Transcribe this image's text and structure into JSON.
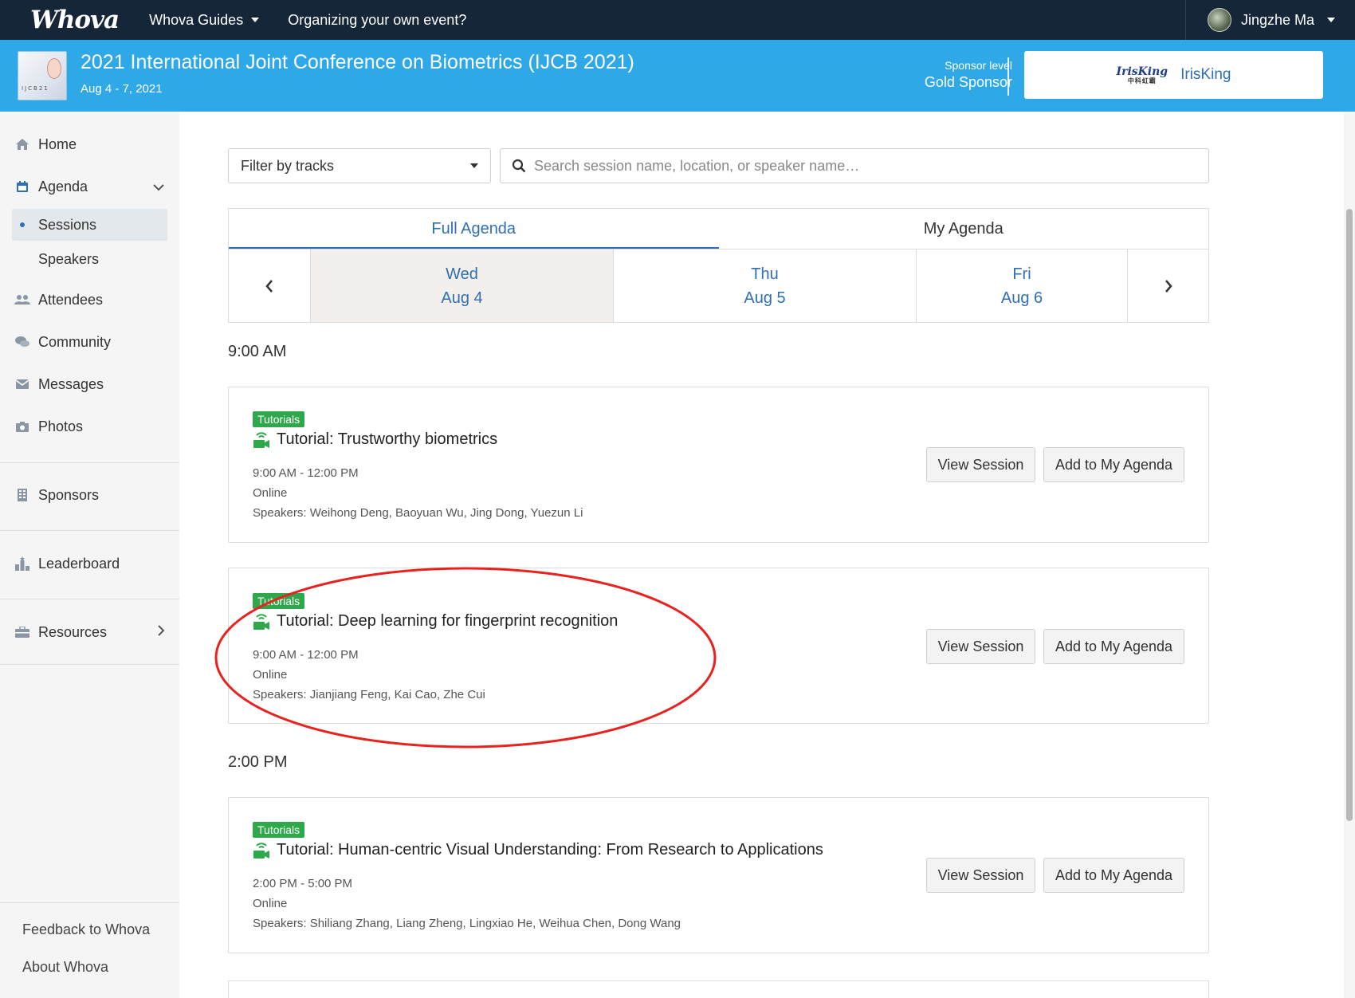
{
  "topnav": {
    "logo": "Whova",
    "guides_label": "Whova Guides",
    "organizing_label": "Organizing your own event?",
    "user_name": "Jingzhe Ma"
  },
  "event": {
    "title": "2021 International Joint Conference on Biometrics (IJCB 2021)",
    "dates": "Aug 4 - 7, 2021",
    "sponsor_level_label": "Sponsor level",
    "sponsor_level_value": "Gold Sponsor",
    "sponsor_name": "IrisKing"
  },
  "sidebar": {
    "items": [
      {
        "label": "Home",
        "icon": "home-icon"
      },
      {
        "label": "Agenda",
        "icon": "calendar-icon"
      },
      {
        "label": "Sessions"
      },
      {
        "label": "Speakers"
      },
      {
        "label": "Attendees",
        "icon": "users-icon"
      },
      {
        "label": "Community",
        "icon": "chat-icon"
      },
      {
        "label": "Messages",
        "icon": "envelope-icon"
      },
      {
        "label": "Photos",
        "icon": "camera-icon"
      },
      {
        "label": "Sponsors",
        "icon": "building-icon"
      },
      {
        "label": "Leaderboard",
        "icon": "leaderboard-icon"
      },
      {
        "label": "Resources",
        "icon": "briefcase-icon"
      }
    ],
    "footer": {
      "feedback": "Feedback to Whova",
      "about": "About Whova"
    }
  },
  "main": {
    "filter_label": "Filter by tracks",
    "search_placeholder": "Search session name, location, or speaker name…",
    "tabs": [
      {
        "label": "Full Agenda",
        "active": true
      },
      {
        "label": "My Agenda",
        "active": false
      }
    ],
    "days": [
      {
        "weekday": "Wed",
        "date": "Aug 4",
        "selected": true
      },
      {
        "weekday": "Thu",
        "date": "Aug 5",
        "selected": false
      },
      {
        "weekday": "Fri",
        "date": "Aug 6",
        "selected": false
      }
    ],
    "time_groups": [
      {
        "time": "9:00 AM"
      },
      {
        "time": "2:00 PM"
      }
    ],
    "sessions": [
      {
        "tag": "Tutorials",
        "title": "Tutorial: Trustworthy biometrics",
        "time": "9:00 AM - 12:00 PM",
        "location": "Online",
        "speakers": "Speakers: Weihong Deng, Baoyuan Wu, Jing Dong, Yuezun Li"
      },
      {
        "tag": "Tutorials",
        "title": "Tutorial: Deep learning for fingerprint recognition",
        "time": "9:00 AM - 12:00 PM",
        "location": "Online",
        "speakers": "Speakers: Jianjiang Feng, Kai Cao, Zhe Cui"
      },
      {
        "tag": "Tutorials",
        "title": "Tutorial: Human-centric Visual Understanding: From Research to Applications",
        "time": "2:00 PM - 5:00 PM",
        "location": "Online",
        "speakers": "Speakers: Shiliang Zhang, Liang Zheng, Lingxiao He, Weihua Chen, Dong Wang"
      }
    ],
    "view_session_label": "View Session",
    "add_agenda_label": "Add to My Agenda"
  },
  "colors": {
    "topnav_bg": "#142638",
    "event_bar_bg": "#2ea8e6",
    "accent_blue": "#2f6fb5",
    "tag_green": "#2ea84a",
    "annotation_red": "#e8231f"
  }
}
